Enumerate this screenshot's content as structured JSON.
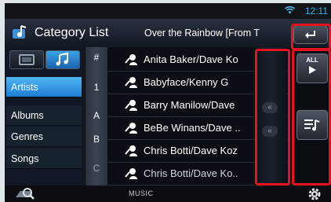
{
  "status": {
    "time": "12:11",
    "wifi_icon": "wifi-icon"
  },
  "header": {
    "title": "Category List",
    "now_playing": "Over the Rainbow [From T",
    "back_icon": "back-arrow-icon"
  },
  "source_toggle": {
    "video_icon": "video-icon",
    "music_icon": "music-note-icon"
  },
  "categories": [
    {
      "label": "Artists",
      "active": true
    },
    {
      "label": "Albums",
      "active": false
    },
    {
      "label": "Genres",
      "active": false
    },
    {
      "label": "Songs",
      "active": false
    }
  ],
  "index_letters": [
    "#",
    "1",
    "A",
    "B",
    "C"
  ],
  "list": {
    "item_icon": "artist-icon",
    "items": [
      "Anita Baker/Dave Ko",
      "Babyface/Kenny G",
      "Barry Manilow/Dave",
      "BeBe Winans/Dave ..",
      "Chris Botti/Dave Koz",
      "Chris Botti/Dave Ko.."
    ]
  },
  "scroll": {
    "chevron_icon": "double-chevron-left-icon"
  },
  "right_buttons": {
    "play_all": "ALL",
    "play_all_icon": "play-icon",
    "queue_icon": "playlist-icon"
  },
  "bottom": {
    "label": "MUSIC",
    "search_icon": "search-icon",
    "settings_icon": "gear-icon"
  },
  "highlight_color": "#e4131f",
  "accent_color": "#2d8fe0"
}
